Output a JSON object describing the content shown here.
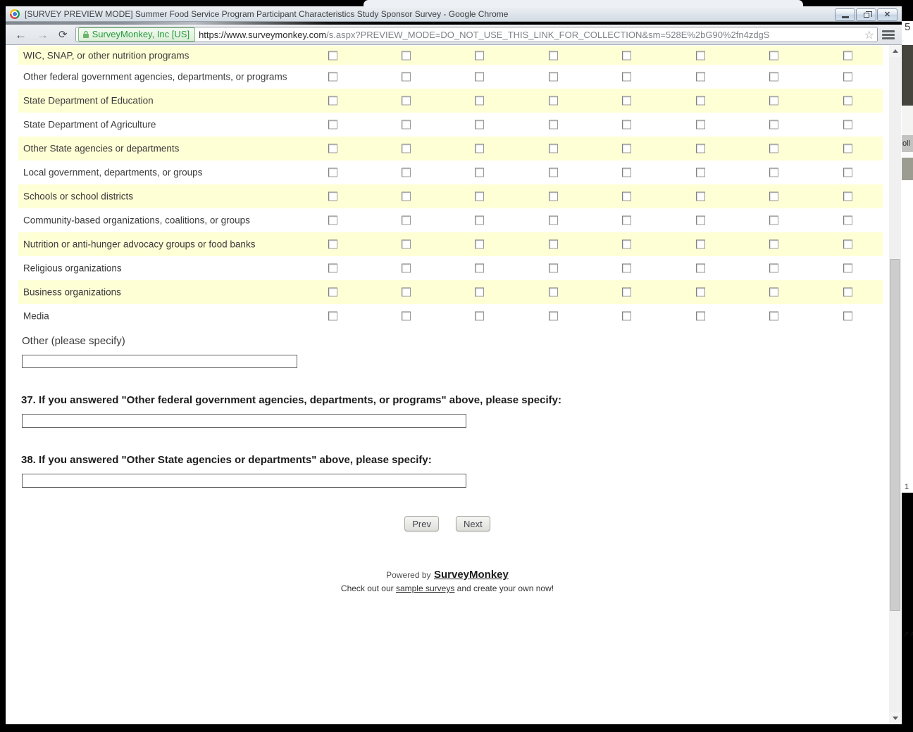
{
  "window": {
    "title": "[SURVEY PREVIEW MODE] Summer Food Service Program Participant Characteristics Study Sponsor Survey - Google Chrome"
  },
  "browser": {
    "ev_badge": "SurveyMonkey, Inc [US]",
    "url_domain": "https://www.surveymonkey.com",
    "url_path": "/s.aspx?PREVIEW_MODE=DO_NOT_USE_THIS_LINK_FOR_COLLECTION&sm=528E%2bG90%2fn4zdgS",
    "bookmark_star": "☆"
  },
  "background_window": {
    "top_digit": "5",
    "chip_text": "oll",
    "mid_number": "1",
    "arrows_text": "⇗⇗"
  },
  "survey": {
    "matrix": {
      "columns": 8,
      "rows": [
        "WIC, SNAP, or other nutrition programs",
        "Other federal government agencies, departments, or programs",
        "State Department of Education",
        "State Department of Agriculture",
        "Other State agencies or departments",
        "Local government, departments, or groups",
        "Schools or school districts",
        "Community-based organizations, coalitions, or groups",
        "Nutrition or anti-hunger advocacy groups or food banks",
        "Religious organizations",
        "Business organizations",
        "Media"
      ]
    },
    "other_label": "Other (please specify)",
    "other_value": "",
    "q37": "37. If you answered \"Other federal government agencies, departments, or programs\" above, please specify:",
    "q37_value": "",
    "q38": "38. If you answered \"Other State agencies or departments\" above, please specify:",
    "q38_value": "",
    "prev_label": "Prev",
    "next_label": "Next",
    "footer": {
      "powered_by": "Powered by",
      "brand": "SurveyMonkey",
      "check_pre": "Check out our ",
      "sample_link": "sample surveys",
      "check_post": " and create your own now!"
    }
  },
  "colors": {
    "row_alt": "#FFFFD6",
    "ev_green": "#259B3C",
    "yellow_band": "#FFFFD6"
  }
}
